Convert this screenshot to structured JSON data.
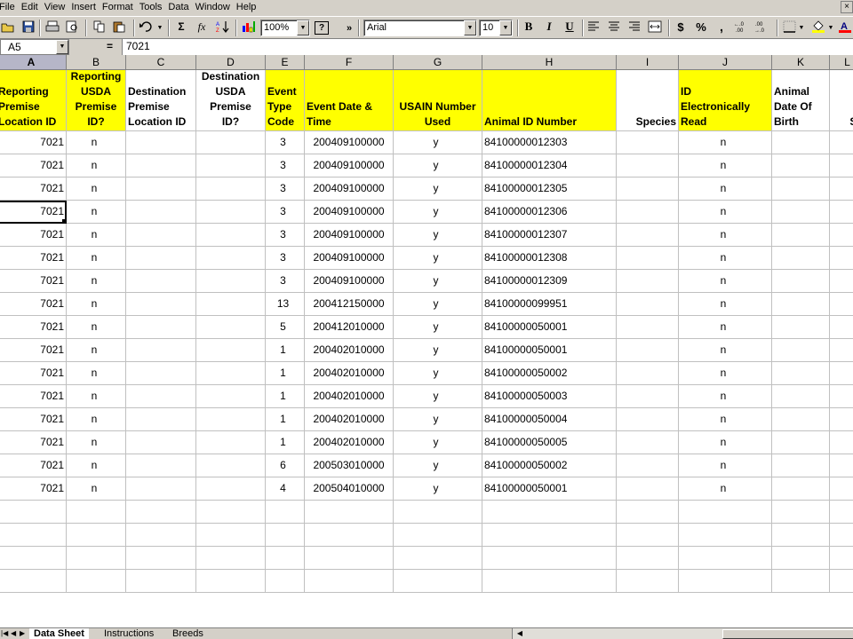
{
  "menu": [
    "File",
    "Edit",
    "View",
    "Insert",
    "Format",
    "Tools",
    "Data",
    "Window",
    "Help"
  ],
  "toolbar": {
    "zoom": "100%",
    "font": "Arial",
    "size": "10",
    "sigma": "Σ",
    "fx": "fx",
    "bold": "B",
    "italic": "I",
    "underline": "U",
    "currency": "$",
    "percent": "%",
    "comma": ",",
    "help": "?",
    "more": "»"
  },
  "formula_bar": {
    "cell_ref": "A5",
    "eq": "=",
    "value": "7021"
  },
  "columns": [
    {
      "letter": "A",
      "header": "Reporting\nPremise\nLocation ID",
      "yellow": true
    },
    {
      "letter": "B",
      "header": "Reporting\nUSDA\nPremise\nID?",
      "yellow": true
    },
    {
      "letter": "C",
      "header": "Destination\nPremise\nLocation ID",
      "yellow": false
    },
    {
      "letter": "D",
      "header": "Destination\nUSDA\nPremise\nID?",
      "yellow": false
    },
    {
      "letter": "E",
      "header": "Event\nType\nCode",
      "yellow": true
    },
    {
      "letter": "F",
      "header": "Event Date &\nTime",
      "yellow": true
    },
    {
      "letter": "G",
      "header": "USAIN Number\nUsed",
      "yellow": true
    },
    {
      "letter": "H",
      "header": "Animal ID Number",
      "yellow": true
    },
    {
      "letter": "I",
      "header": "Species",
      "yellow": false
    },
    {
      "letter": "J",
      "header": "ID\nElectronically\nRead",
      "yellow": true
    },
    {
      "letter": "K",
      "header": "Animal\nDate Of\nBirth",
      "yellow": false
    },
    {
      "letter": "L",
      "header": "Se",
      "yellow": false
    }
  ],
  "rows": [
    [
      "7021",
      "n",
      "",
      "",
      "3",
      "200409100000",
      "y",
      "84100000012303",
      "",
      "n",
      "",
      ""
    ],
    [
      "7021",
      "n",
      "",
      "",
      "3",
      "200409100000",
      "y",
      "84100000012304",
      "",
      "n",
      "",
      ""
    ],
    [
      "7021",
      "n",
      "",
      "",
      "3",
      "200409100000",
      "y",
      "84100000012305",
      "",
      "n",
      "",
      ""
    ],
    [
      "7021",
      "n",
      "",
      "",
      "3",
      "200409100000",
      "y",
      "84100000012306",
      "",
      "n",
      "",
      ""
    ],
    [
      "7021",
      "n",
      "",
      "",
      "3",
      "200409100000",
      "y",
      "84100000012307",
      "",
      "n",
      "",
      ""
    ],
    [
      "7021",
      "n",
      "",
      "",
      "3",
      "200409100000",
      "y",
      "84100000012308",
      "",
      "n",
      "",
      ""
    ],
    [
      "7021",
      "n",
      "",
      "",
      "3",
      "200409100000",
      "y",
      "84100000012309",
      "",
      "n",
      "",
      ""
    ],
    [
      "7021",
      "n",
      "",
      "",
      "13",
      "200412150000",
      "y",
      "84100000099951",
      "",
      "n",
      "",
      ""
    ],
    [
      "7021",
      "n",
      "",
      "",
      "5",
      "200412010000",
      "y",
      "84100000050001",
      "",
      "n",
      "",
      ""
    ],
    [
      "7021",
      "n",
      "",
      "",
      "1",
      "200402010000",
      "y",
      "84100000050001",
      "",
      "n",
      "",
      ""
    ],
    [
      "7021",
      "n",
      "",
      "",
      "1",
      "200402010000",
      "y",
      "84100000050002",
      "",
      "n",
      "",
      ""
    ],
    [
      "7021",
      "n",
      "",
      "",
      "1",
      "200402010000",
      "y",
      "84100000050003",
      "",
      "n",
      "",
      ""
    ],
    [
      "7021",
      "n",
      "",
      "",
      "1",
      "200402010000",
      "y",
      "84100000050004",
      "",
      "n",
      "",
      ""
    ],
    [
      "7021",
      "n",
      "",
      "",
      "1",
      "200402010000",
      "y",
      "84100000050005",
      "",
      "n",
      "",
      ""
    ],
    [
      "7021",
      "n",
      "",
      "",
      "6",
      "200503010000",
      "y",
      "84100000050002",
      "",
      "n",
      "",
      ""
    ],
    [
      "7021",
      "n",
      "",
      "",
      "4",
      "200504010000",
      "y",
      "84100000050001",
      "",
      "n",
      "",
      ""
    ]
  ],
  "sheet_tabs": [
    "Data Sheet",
    "Instructions",
    "Breeds"
  ],
  "active_tab": "Data Sheet",
  "colors": {
    "header_fill": "#ffff00",
    "chrome": "#d4d0c8",
    "gridline": "#c0c0c0"
  }
}
